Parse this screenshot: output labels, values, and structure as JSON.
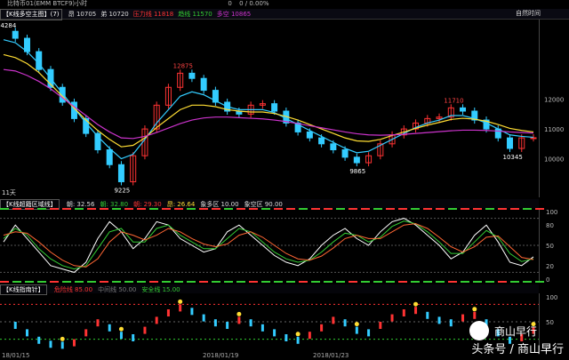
{
  "top": {
    "title": "比特币01(EMM BTCF9)小时",
    "val1": "0",
    "val2": "0 / 0.00%"
  },
  "info": {
    "tag": "【K线多空主图】(7)",
    "items": [
      {
        "text": "昂 10705",
        "color": "#dddddd"
      },
      {
        "text": "弟 10720",
        "color": "#dddddd"
      },
      {
        "text": "压力线 11818",
        "color": "#ff3333"
      },
      {
        "text": "趋线 11570",
        "color": "#33cc33"
      },
      {
        "text": "多空 10865",
        "color": "#cc33cc"
      }
    ],
    "right": "自然时间"
  },
  "main": {
    "price_labels": [
      "12000",
      "11000",
      "10000"
    ],
    "annotations": [
      {
        "text": "12875",
        "color": "#ff4444"
      },
      {
        "text": "11710",
        "color": "#ff4444"
      },
      {
        "text": "9225",
        "color": "#ffffff"
      },
      {
        "text": "9865",
        "color": "#ffffff"
      },
      {
        "text": "10345",
        "color": "#ffffff"
      },
      {
        "text": "14284",
        "color": "#ffffff"
      }
    ],
    "period": "11天"
  },
  "osc": {
    "tag": "【K线超籍区域线】",
    "items": [
      {
        "text": "朝: 32.56",
        "color": "#dddddd"
      },
      {
        "text": "朝: 32.80",
        "color": "#33cc33"
      },
      {
        "text": "朝: 29.30",
        "color": "#ff3333"
      },
      {
        "text": "昂: 26.64",
        "color": "#ffdd33"
      },
      {
        "text": "象多区 10.00",
        "color": "#dddddd"
      },
      {
        "text": "象空区 90.00",
        "color": "#dddddd"
      }
    ],
    "levels": [
      "100",
      "80",
      "50",
      "20",
      "0"
    ]
  },
  "third": {
    "tag": "【K线指南针】",
    "items": [
      {
        "text": "危险线 85.00",
        "color": "#ff3333"
      },
      {
        "text": "中间线 50.00",
        "color": "#777777"
      },
      {
        "text": "安全线 15.00",
        "color": "#33cc33"
      }
    ],
    "levels": [
      "100",
      "50",
      "0"
    ]
  },
  "dates": [
    "18/01/15",
    "2018/01/19",
    "2018/01/23"
  ],
  "watermark": "头条号 / 商山早行",
  "logo_text": "商山早行",
  "chart_data": [
    {
      "type": "line",
      "series": [
        {
          "values": [
            14284,
            14050,
            13600,
            13000,
            12400,
            11900,
            11350,
            10850,
            10300,
            9800,
            9225,
            10100,
            11000,
            11800,
            12400,
            12875,
            12700,
            12300,
            11900,
            11600,
            11500,
            11800,
            11850,
            11600,
            11200,
            10900,
            10700,
            10500,
            10300,
            10050,
            9865,
            10100,
            10500,
            10800,
            11000,
            11200,
            11350,
            11400,
            11710,
            11600,
            11300,
            11000,
            10700,
            10345,
            10700,
            10705
          ]
        },
        {
          "values": [
            14000,
            13900,
            13600,
            13200,
            12700,
            12200,
            11700,
            11200,
            10750,
            10350,
            10000,
            10150,
            10650,
            11200,
            11650,
            12100,
            12250,
            12150,
            11950,
            11750,
            11650,
            11650,
            11650,
            11550,
            11350,
            11150,
            10950,
            10750,
            10550,
            10350,
            10200,
            10250,
            10450,
            10650,
            10850,
            11050,
            11200,
            11300,
            11450,
            11450,
            11350,
            11200,
            11000,
            10800,
            10750,
            10720
          ]
        },
        {
          "values": [
            13500,
            13400,
            13200,
            12900,
            12500,
            12100,
            11700,
            11300,
            10950,
            10650,
            10400,
            10450,
            10700,
            11050,
            11350,
            11650,
            11800,
            11800,
            11750,
            11650,
            11600,
            11570,
            11570,
            11520,
            11420,
            11300,
            11150,
            11000,
            10850,
            10700,
            10600,
            10580,
            10650,
            10780,
            10900,
            11020,
            11130,
            11220,
            11320,
            11360,
            11330,
            11260,
            11150,
            11020,
            10950,
            10900
          ]
        },
        {
          "values": [
            13000,
            12950,
            12800,
            12600,
            12350,
            12050,
            11750,
            11450,
            11150,
            10900,
            10700,
            10680,
            10750,
            10880,
            11030,
            11180,
            11300,
            11370,
            11400,
            11400,
            11380,
            11360,
            11340,
            11300,
            11250,
            11180,
            11110,
            11040,
            10970,
            10900,
            10840,
            10800,
            10790,
            10800,
            10820,
            10850,
            10880,
            10910,
            10940,
            10960,
            10960,
            10950,
            10930,
            10900,
            10880,
            10865
          ]
        }
      ]
    },
    {
      "type": "line",
      "series": [
        {
          "values": [
            55,
            80,
            60,
            40,
            20,
            15,
            10,
            25,
            60,
            85,
            70,
            45,
            60,
            85,
            80,
            60,
            50,
            40,
            45,
            70,
            80,
            65,
            50,
            35,
            25,
            20,
            30,
            50,
            65,
            75,
            60,
            50,
            70,
            85,
            90,
            80,
            65,
            50,
            30,
            40,
            65,
            80,
            55,
            25,
            20,
            33
          ]
        },
        {
          "values": [
            60,
            75,
            65,
            45,
            30,
            20,
            15,
            20,
            45,
            70,
            75,
            55,
            55,
            75,
            80,
            65,
            55,
            45,
            45,
            60,
            75,
            70,
            55,
            40,
            30,
            25,
            28,
            40,
            55,
            68,
            65,
            55,
            62,
            78,
            86,
            82,
            70,
            55,
            38,
            38,
            55,
            72,
            62,
            38,
            26,
            30
          ]
        },
        {
          "values": [
            65,
            70,
            68,
            55,
            40,
            28,
            20,
            18,
            30,
            55,
            70,
            65,
            58,
            65,
            75,
            70,
            60,
            52,
            48,
            52,
            65,
            70,
            62,
            50,
            38,
            30,
            28,
            34,
            46,
            60,
            65,
            60,
            60,
            70,
            80,
            82,
            75,
            62,
            48,
            40,
            48,
            62,
            64,
            48,
            32,
            29
          ]
        }
      ]
    },
    {
      "type": "line",
      "series": [
        {
          "values": [
            70,
            50,
            35,
            20,
            12,
            10,
            15,
            35,
            55,
            45,
            30,
            25,
            40,
            60,
            75,
            85,
            78,
            65,
            55,
            50,
            60,
            55,
            45,
            35,
            25,
            20,
            30,
            45,
            60,
            55,
            40,
            35,
            50,
            65,
            75,
            80,
            70,
            60,
            55,
            65,
            70,
            55,
            35,
            20,
            25,
            40
          ]
        }
      ]
    }
  ]
}
